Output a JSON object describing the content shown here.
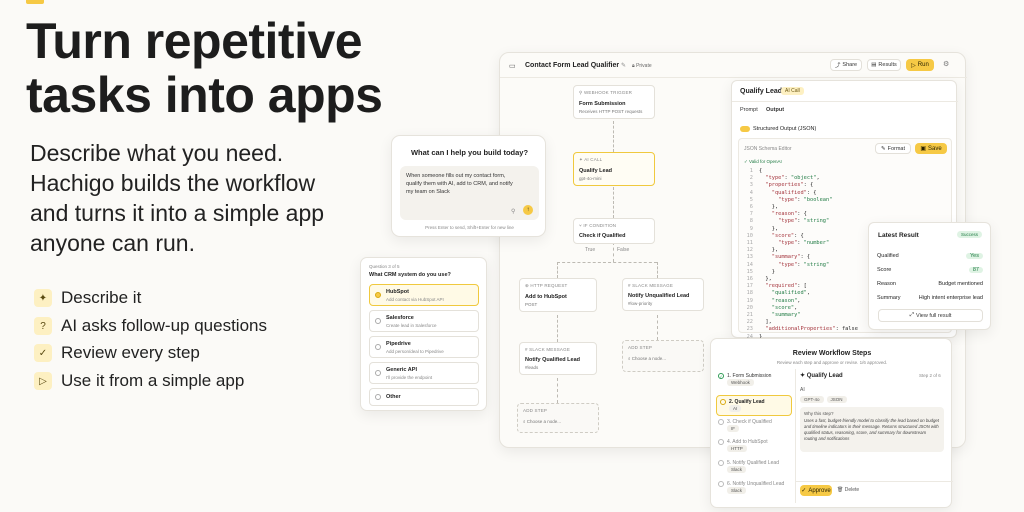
{
  "hero": {
    "title_line1": "Turn repetitive",
    "title_line2": "tasks into apps",
    "desc_line1": "Describe what you need.",
    "desc_line2": "Hachigo builds the workflow",
    "desc_line3": "and turns it into a simple app",
    "desc_line4": "anyone can run.",
    "features": [
      {
        "icon": "sparkle-icon",
        "glyph": "✦",
        "label": "Describe it"
      },
      {
        "icon": "question-icon",
        "glyph": "?",
        "label": "AI asks follow-up questions"
      },
      {
        "icon": "checkbox-icon",
        "glyph": "✓",
        "label": "Review every step"
      },
      {
        "icon": "play-icon",
        "glyph": "▷",
        "label": "Use it from a simple app"
      }
    ]
  },
  "prompt_card": {
    "title": "What can I help you build today?",
    "text": "When someone fills out my contact form, qualify them with AI, add to CRM, and notify my team on Slack",
    "hint": "Press Enter to send, Shift+Enter for new line"
  },
  "question_card": {
    "counter": "Question 3 of 5",
    "question": "What CRM system do you use?",
    "options": [
      {
        "name": "HubSpot",
        "desc": "Add contact via HubSpot API"
      },
      {
        "name": "Salesforce",
        "desc": "Create lead in Salesforce"
      },
      {
        "name": "Pipedrive",
        "desc": "Add person/deal to Pipedrive"
      },
      {
        "name": "Generic API",
        "desc": "I'll provide the endpoint"
      },
      {
        "name": "Other",
        "desc": ""
      }
    ]
  },
  "workflow": {
    "title": "Contact Form Lead Qualifier",
    "privacy": "Private",
    "share": "Share",
    "results": "Results",
    "run": "Run",
    "nodes": {
      "webhook": {
        "type": "WEBHOOK TRIGGER",
        "name": "Form Submission",
        "desc": "Receives HTTP POST requests"
      },
      "ai": {
        "type": "AI CALL",
        "name": "Qualify Lead",
        "desc": "gpt-4o-mini"
      },
      "cond": {
        "type": "IF CONDITION",
        "name": "Check if Qualified"
      },
      "http": {
        "type": "HTTP REQUEST",
        "name": "Add to HubSpot",
        "desc": "POST"
      },
      "slack1": {
        "type": "SLACK MESSAGE",
        "name": "Notify Unqualified Lead",
        "desc": "#low-priority"
      },
      "slack2": {
        "type": "SLACK MESSAGE",
        "name": "Notify Qualified Lead",
        "desc": "#leads"
      }
    },
    "branch_true": "True",
    "branch_false": "False",
    "add_step": "ADD STEP",
    "choose_node": "Choose a node..."
  },
  "side_panel": {
    "title": "Qualify Lead",
    "badge": "AI Call",
    "tab_prompt": "Prompt",
    "tab_output": "Output",
    "toggle_label": "Structured Output (JSON)",
    "editor_label": "JSON Schema Editor",
    "format": "Format",
    "save": "Save",
    "valid": "Valid for OpenAI",
    "code": [
      "{",
      "  \"type\": \"object\",",
      "  \"properties\": {",
      "    \"qualified\": {",
      "      \"type\": \"boolean\"",
      "    },",
      "    \"reason\": {",
      "      \"type\": \"string\"",
      "    },",
      "    \"score\": {",
      "      \"type\": \"number\"",
      "    },",
      "    \"summary\": {",
      "      \"type\": \"string\"",
      "    }",
      "  },",
      "  \"required\": [",
      "    \"qualified\",",
      "    \"reason\",",
      "    \"score\",",
      "    \"summary\"",
      "  ],",
      "  \"additionalProperties\": false",
      "}"
    ]
  },
  "result_card": {
    "title": "Latest Result",
    "status": "Success",
    "rows": [
      {
        "key": "Qualified",
        "value": "Yes"
      },
      {
        "key": "Score",
        "value": "87"
      },
      {
        "key": "Reason",
        "value": "Budget mentioned"
      },
      {
        "key": "Summary",
        "value": "High intent enterprise lead"
      }
    ],
    "button": "View full result"
  },
  "review_card": {
    "title": "Review Workflow Steps",
    "subtitle": "Review each step and approve or revise. 1/6 approved.",
    "steps": [
      {
        "name": "1. Form Submission",
        "tag": "Webhook"
      },
      {
        "name": "2. Qualify Lead",
        "tag": "AI"
      },
      {
        "name": "3. Check if Qualified",
        "tag": "IF"
      },
      {
        "name": "4. Add to HubSpot",
        "tag": "HTTP"
      },
      {
        "name": "5. Notify Qualified Lead",
        "tag": "Slack"
      },
      {
        "name": "6. Notify Unqualified Lead",
        "tag": "Slack"
      }
    ],
    "detail_title": "Qualify Lead",
    "detail_step": "Step 2 of 6",
    "detail_type": "AI",
    "detail_tags": [
      "GPT-4o",
      "JSON"
    ],
    "why_label": "Why this step?",
    "why_text": "Uses a fast, budget-friendly model to classify the lead based on budget and timeline indicators in their message. Returns structured JSON with qualified status, reasoning, score, and summary for downstream routing and notifications",
    "approve": "Approve",
    "delete": "Delete"
  }
}
